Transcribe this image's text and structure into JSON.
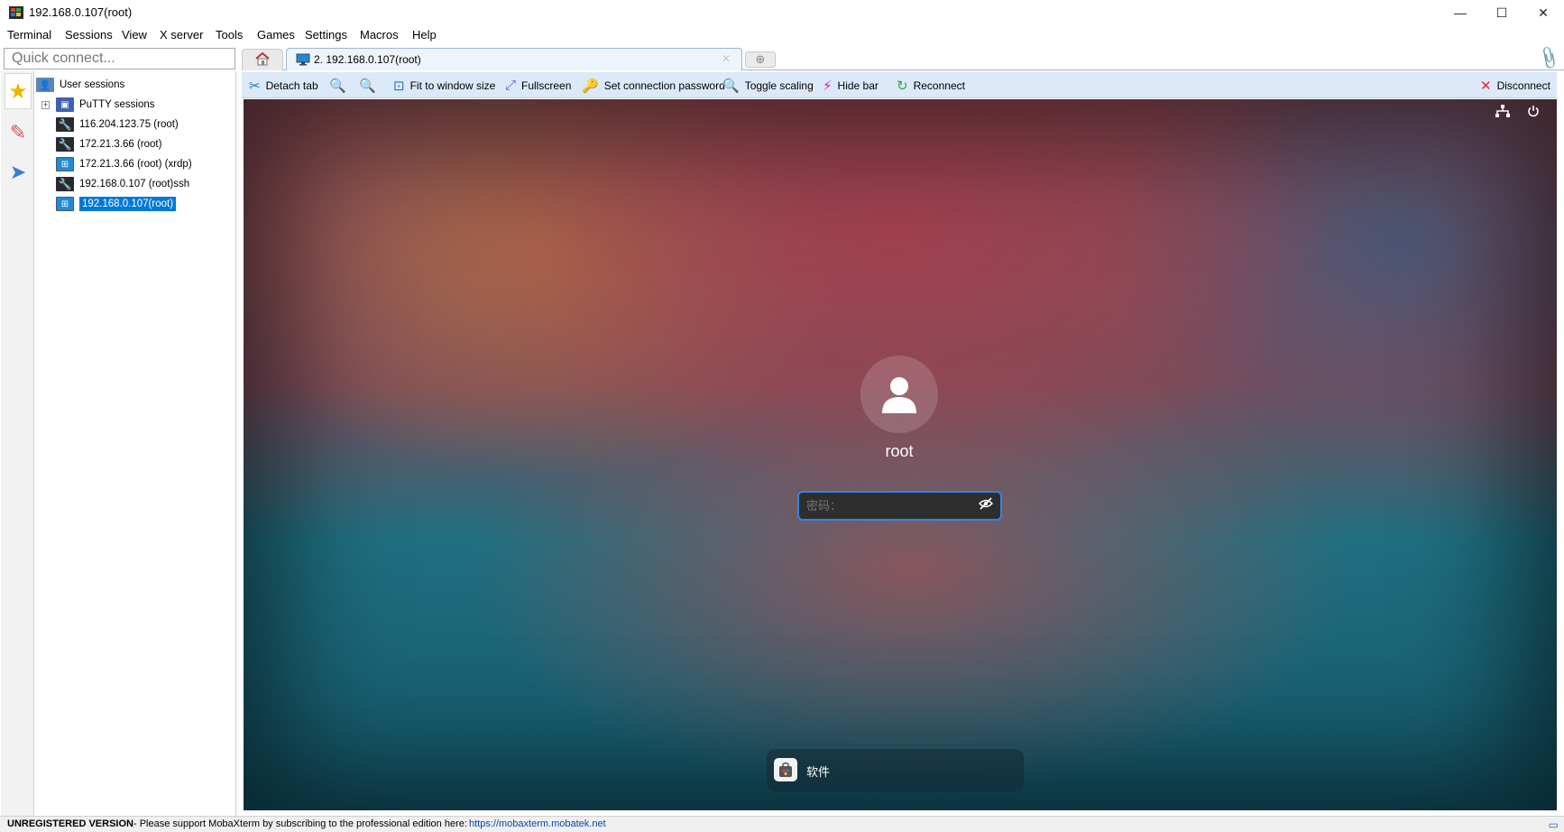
{
  "window": {
    "title": "192.168.0.107(root)",
    "minimize": "—",
    "maximize": "☐",
    "close": "✕"
  },
  "menu": [
    "Terminal",
    "Sessions",
    "View",
    "X server",
    "Tools",
    "Games",
    "Settings",
    "Macros",
    "Help"
  ],
  "quick_connect": {
    "placeholder": "Quick connect..."
  },
  "tabs": {
    "active_label": "2. 192.168.0.107(root)",
    "close": "✕"
  },
  "sessions": {
    "root_label": "User sessions",
    "putty_label": "PuTTY sessions",
    "items": [
      {
        "label": "116.204.123.75 (root)",
        "type": "ssh"
      },
      {
        "label": "172.21.3.66 (root)",
        "type": "ssh"
      },
      {
        "label": "172.21.3.66 (root) (xrdp)",
        "type": "rdp"
      },
      {
        "label": "192.168.0.107 (root)ssh",
        "type": "ssh"
      },
      {
        "label": "192.168.0.107(root)",
        "type": "rdp",
        "selected": true
      }
    ]
  },
  "toolbar": {
    "detach": "Detach tab",
    "fit": "Fit to window size",
    "fullscreen": "Fullscreen",
    "set_password": "Set connection password",
    "toggle_scaling": "Toggle scaling",
    "hide_bar": "Hide bar",
    "reconnect": "Reconnect",
    "disconnect": "Disconnect"
  },
  "remote": {
    "username": "root",
    "password_placeholder": "密码：",
    "dock_app_label": "软件"
  },
  "status": {
    "unregistered": "UNREGISTERED VERSION",
    "message": " -  Please support MobaXterm by subscribing to the professional edition here:",
    "link": "https://mobaxterm.mobatek.net"
  },
  "colors": {
    "accent": "#0078d7",
    "toolbar_bg": "#dbe9f8",
    "focus_ring": "#3584e4"
  }
}
